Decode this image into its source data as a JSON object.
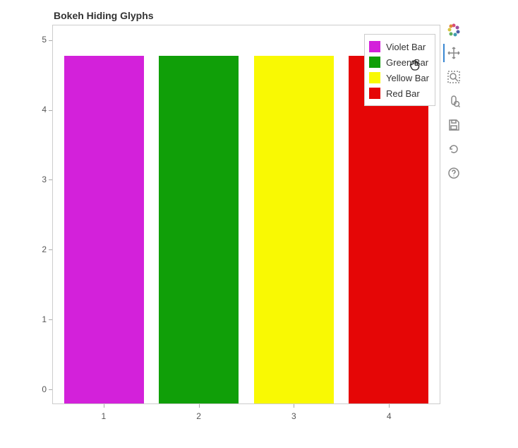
{
  "chart_data": {
    "type": "bar",
    "title": "Bokeh Hiding Glyphs",
    "categories": [
      1,
      2,
      3,
      4
    ],
    "values": [
      5,
      5,
      5,
      5
    ],
    "series": [
      {
        "name": "Violet Bar",
        "color": "#d321da",
        "x": 1,
        "y": 5
      },
      {
        "name": "Green Bar",
        "color": "#109f08",
        "x": 2,
        "y": 5
      },
      {
        "name": "Yellow Bar",
        "color": "#f9f903",
        "x": 3,
        "y": 5
      },
      {
        "name": "Red Bar",
        "color": "#e50606",
        "x": 4,
        "y": 5
      }
    ],
    "xlabel": "",
    "ylabel": "",
    "x_ticks": [
      1,
      2,
      3,
      4
    ],
    "y_ticks": [
      0,
      1,
      2,
      3,
      4,
      5
    ],
    "xlim": [
      0.46,
      4.54
    ],
    "ylim": [
      -0.22,
      5.22
    ],
    "legend_position": "top_right"
  },
  "toolbar": {
    "tools": [
      {
        "name": "pan",
        "active": true
      },
      {
        "name": "box-zoom",
        "active": false
      },
      {
        "name": "wheel-zoom",
        "active": false
      },
      {
        "name": "save",
        "active": false
      },
      {
        "name": "reset",
        "active": false
      },
      {
        "name": "help",
        "active": false
      }
    ]
  }
}
